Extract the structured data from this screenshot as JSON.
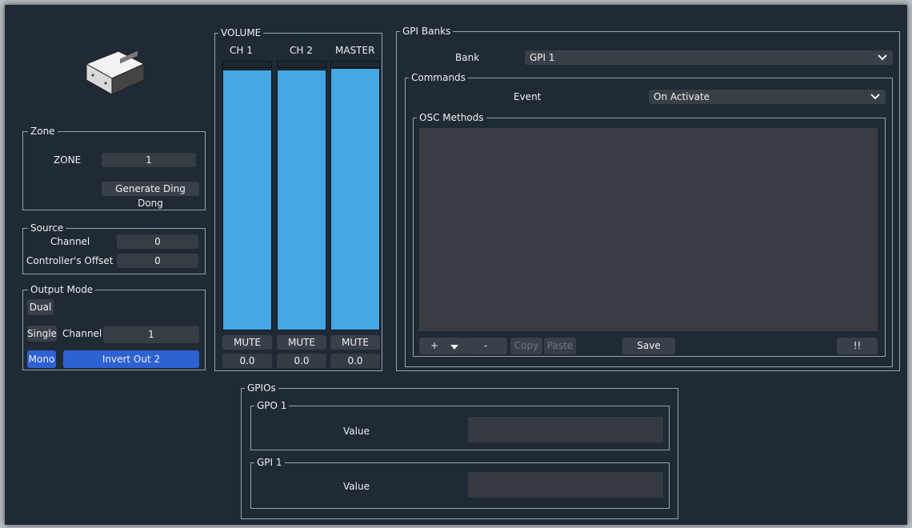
{
  "zone": {
    "title": "Zone",
    "zone_label": "ZONE",
    "zone_value": "1",
    "ding_dong_button": "Generate Ding Dong"
  },
  "source": {
    "title": "Source",
    "channel_label": "Channel",
    "channel_value": "0",
    "offset_label": "Controller's Offset",
    "offset_value": "0"
  },
  "output_mode": {
    "title": "Output Mode",
    "dual": "Dual",
    "single": "Single",
    "channel_label": "Channel",
    "channel_value": "1",
    "mono": "Mono",
    "invert": "Invert Out 2"
  },
  "volume": {
    "title": "VOLUME",
    "channels": [
      {
        "name": "CH 1",
        "mute": "MUTE",
        "value": "0.0",
        "level": 1.0
      },
      {
        "name": "CH 2",
        "mute": "MUTE",
        "value": "0.0",
        "level": 1.0
      },
      {
        "name": "MASTER",
        "mute": "MUTE",
        "value": "0.0",
        "level": 1.0
      }
    ]
  },
  "gpi_banks": {
    "title": "GPI Banks",
    "bank_label": "Bank",
    "bank_value": "GPI 1",
    "commands": {
      "title": "Commands",
      "event_label": "Event",
      "event_value": "On Activate",
      "osc": {
        "title": "OSC Methods",
        "add": "+",
        "remove": "-",
        "copy": "Copy",
        "paste": "Paste",
        "save": "Save",
        "alert": "!!"
      }
    }
  },
  "gpios": {
    "title": "GPIOs",
    "gpo": {
      "title": "GPO 1",
      "value_label": "Value",
      "value": ""
    },
    "gpi": {
      "title": "GPI 1",
      "value_label": "Value",
      "value": ""
    }
  },
  "colors": {
    "background": "#1f2a35",
    "meter": "#44a7e4",
    "accent_blue": "#2d62d3",
    "field": "#353c44"
  },
  "icons": {
    "device": "device-box-icon",
    "dropdown": "chevron-down-icon",
    "add_menu": "caret-down-icon"
  }
}
